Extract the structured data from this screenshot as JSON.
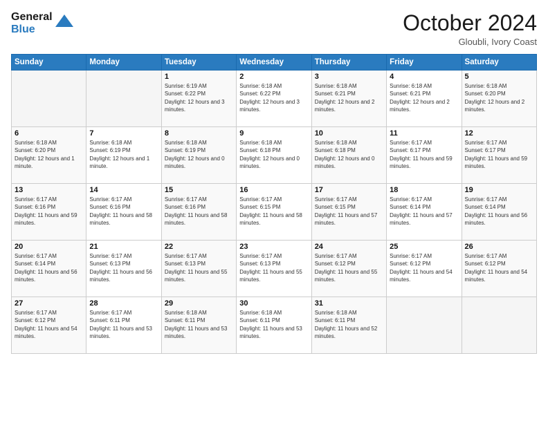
{
  "logo": {
    "line1": "General",
    "line2": "Blue"
  },
  "title": "October 2024",
  "subtitle": "Gloubli, Ivory Coast",
  "days": [
    "Sunday",
    "Monday",
    "Tuesday",
    "Wednesday",
    "Thursday",
    "Friday",
    "Saturday"
  ],
  "weeks": [
    [
      {
        "day": "",
        "sunrise": "",
        "sunset": "",
        "daylight": ""
      },
      {
        "day": "",
        "sunrise": "",
        "sunset": "",
        "daylight": ""
      },
      {
        "day": "1",
        "sunrise": "Sunrise: 6:19 AM",
        "sunset": "Sunset: 6:22 PM",
        "daylight": "Daylight: 12 hours and 3 minutes."
      },
      {
        "day": "2",
        "sunrise": "Sunrise: 6:18 AM",
        "sunset": "Sunset: 6:22 PM",
        "daylight": "Daylight: 12 hours and 3 minutes."
      },
      {
        "day": "3",
        "sunrise": "Sunrise: 6:18 AM",
        "sunset": "Sunset: 6:21 PM",
        "daylight": "Daylight: 12 hours and 2 minutes."
      },
      {
        "day": "4",
        "sunrise": "Sunrise: 6:18 AM",
        "sunset": "Sunset: 6:21 PM",
        "daylight": "Daylight: 12 hours and 2 minutes."
      },
      {
        "day": "5",
        "sunrise": "Sunrise: 6:18 AM",
        "sunset": "Sunset: 6:20 PM",
        "daylight": "Daylight: 12 hours and 2 minutes."
      }
    ],
    [
      {
        "day": "6",
        "sunrise": "Sunrise: 6:18 AM",
        "sunset": "Sunset: 6:20 PM",
        "daylight": "Daylight: 12 hours and 1 minute."
      },
      {
        "day": "7",
        "sunrise": "Sunrise: 6:18 AM",
        "sunset": "Sunset: 6:19 PM",
        "daylight": "Daylight: 12 hours and 1 minute."
      },
      {
        "day": "8",
        "sunrise": "Sunrise: 6:18 AM",
        "sunset": "Sunset: 6:19 PM",
        "daylight": "Daylight: 12 hours and 0 minutes."
      },
      {
        "day": "9",
        "sunrise": "Sunrise: 6:18 AM",
        "sunset": "Sunset: 6:18 PM",
        "daylight": "Daylight: 12 hours and 0 minutes."
      },
      {
        "day": "10",
        "sunrise": "Sunrise: 6:18 AM",
        "sunset": "Sunset: 6:18 PM",
        "daylight": "Daylight: 12 hours and 0 minutes."
      },
      {
        "day": "11",
        "sunrise": "Sunrise: 6:17 AM",
        "sunset": "Sunset: 6:17 PM",
        "daylight": "Daylight: 11 hours and 59 minutes."
      },
      {
        "day": "12",
        "sunrise": "Sunrise: 6:17 AM",
        "sunset": "Sunset: 6:17 PM",
        "daylight": "Daylight: 11 hours and 59 minutes."
      }
    ],
    [
      {
        "day": "13",
        "sunrise": "Sunrise: 6:17 AM",
        "sunset": "Sunset: 6:16 PM",
        "daylight": "Daylight: 11 hours and 59 minutes."
      },
      {
        "day": "14",
        "sunrise": "Sunrise: 6:17 AM",
        "sunset": "Sunset: 6:16 PM",
        "daylight": "Daylight: 11 hours and 58 minutes."
      },
      {
        "day": "15",
        "sunrise": "Sunrise: 6:17 AM",
        "sunset": "Sunset: 6:16 PM",
        "daylight": "Daylight: 11 hours and 58 minutes."
      },
      {
        "day": "16",
        "sunrise": "Sunrise: 6:17 AM",
        "sunset": "Sunset: 6:15 PM",
        "daylight": "Daylight: 11 hours and 58 minutes."
      },
      {
        "day": "17",
        "sunrise": "Sunrise: 6:17 AM",
        "sunset": "Sunset: 6:15 PM",
        "daylight": "Daylight: 11 hours and 57 minutes."
      },
      {
        "day": "18",
        "sunrise": "Sunrise: 6:17 AM",
        "sunset": "Sunset: 6:14 PM",
        "daylight": "Daylight: 11 hours and 57 minutes."
      },
      {
        "day": "19",
        "sunrise": "Sunrise: 6:17 AM",
        "sunset": "Sunset: 6:14 PM",
        "daylight": "Daylight: 11 hours and 56 minutes."
      }
    ],
    [
      {
        "day": "20",
        "sunrise": "Sunrise: 6:17 AM",
        "sunset": "Sunset: 6:14 PM",
        "daylight": "Daylight: 11 hours and 56 minutes."
      },
      {
        "day": "21",
        "sunrise": "Sunrise: 6:17 AM",
        "sunset": "Sunset: 6:13 PM",
        "daylight": "Daylight: 11 hours and 56 minutes."
      },
      {
        "day": "22",
        "sunrise": "Sunrise: 6:17 AM",
        "sunset": "Sunset: 6:13 PM",
        "daylight": "Daylight: 11 hours and 55 minutes."
      },
      {
        "day": "23",
        "sunrise": "Sunrise: 6:17 AM",
        "sunset": "Sunset: 6:13 PM",
        "daylight": "Daylight: 11 hours and 55 minutes."
      },
      {
        "day": "24",
        "sunrise": "Sunrise: 6:17 AM",
        "sunset": "Sunset: 6:12 PM",
        "daylight": "Daylight: 11 hours and 55 minutes."
      },
      {
        "day": "25",
        "sunrise": "Sunrise: 6:17 AM",
        "sunset": "Sunset: 6:12 PM",
        "daylight": "Daylight: 11 hours and 54 minutes."
      },
      {
        "day": "26",
        "sunrise": "Sunrise: 6:17 AM",
        "sunset": "Sunset: 6:12 PM",
        "daylight": "Daylight: 11 hours and 54 minutes."
      }
    ],
    [
      {
        "day": "27",
        "sunrise": "Sunrise: 6:17 AM",
        "sunset": "Sunset: 6:12 PM",
        "daylight": "Daylight: 11 hours and 54 minutes."
      },
      {
        "day": "28",
        "sunrise": "Sunrise: 6:17 AM",
        "sunset": "Sunset: 6:11 PM",
        "daylight": "Daylight: 11 hours and 53 minutes."
      },
      {
        "day": "29",
        "sunrise": "Sunrise: 6:18 AM",
        "sunset": "Sunset: 6:11 PM",
        "daylight": "Daylight: 11 hours and 53 minutes."
      },
      {
        "day": "30",
        "sunrise": "Sunrise: 6:18 AM",
        "sunset": "Sunset: 6:11 PM",
        "daylight": "Daylight: 11 hours and 53 minutes."
      },
      {
        "day": "31",
        "sunrise": "Sunrise: 6:18 AM",
        "sunset": "Sunset: 6:11 PM",
        "daylight": "Daylight: 11 hours and 52 minutes."
      },
      {
        "day": "",
        "sunrise": "",
        "sunset": "",
        "daylight": ""
      },
      {
        "day": "",
        "sunrise": "",
        "sunset": "",
        "daylight": ""
      }
    ]
  ]
}
